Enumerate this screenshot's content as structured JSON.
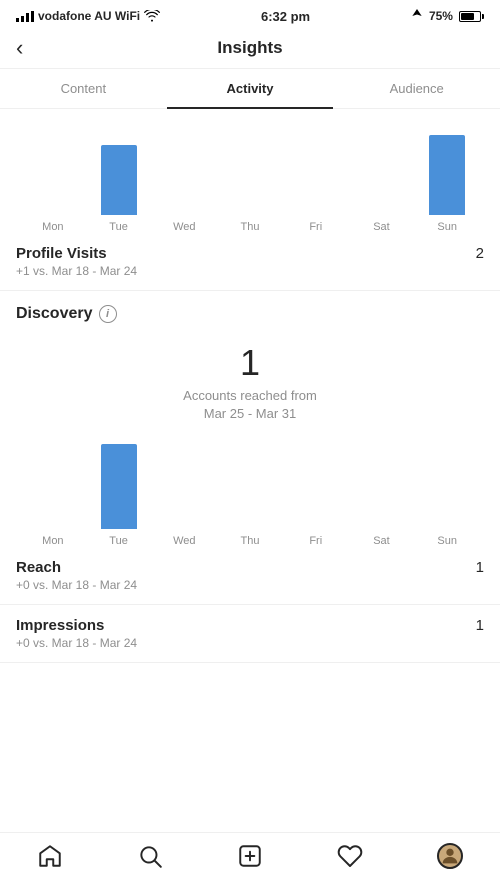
{
  "statusBar": {
    "carrier": "vodafone AU WiFi",
    "time": "6:32 pm",
    "battery": "75%"
  },
  "header": {
    "title": "Insights",
    "backLabel": "<"
  },
  "tabs": [
    {
      "id": "content",
      "label": "Content",
      "active": false
    },
    {
      "id": "activity",
      "label": "Activity",
      "active": true
    },
    {
      "id": "audience",
      "label": "Audience",
      "active": false
    }
  ],
  "topChart": {
    "days": [
      "Mon",
      "Tue",
      "Wed",
      "Thu",
      "Fri",
      "Sat",
      "Sun"
    ],
    "values": [
      0,
      70,
      0,
      0,
      0,
      0,
      80
    ]
  },
  "profileVisits": {
    "label": "Profile Visits",
    "value": "2",
    "comparison": "+1 vs. Mar 18 - Mar 24"
  },
  "discovery": {
    "sectionLabel": "Discovery",
    "infoIcon": "i",
    "accountsNumber": "1",
    "accountsLabel": "Accounts reached from\nMar 25 - Mar 31",
    "chart": {
      "days": [
        "Mon",
        "Tue",
        "Wed",
        "Thu",
        "Fri",
        "Sat",
        "Sun"
      ],
      "values": [
        0,
        85,
        0,
        0,
        0,
        0,
        0
      ]
    },
    "reach": {
      "label": "Reach",
      "value": "1",
      "comparison": "+0 vs. Mar 18 - Mar 24"
    },
    "impressions": {
      "label": "Impressions",
      "value": "1",
      "comparison": "+0 vs. Mar 18 - Mar 24"
    }
  },
  "bottomNav": {
    "items": [
      {
        "id": "home",
        "icon": "home"
      },
      {
        "id": "search",
        "icon": "search"
      },
      {
        "id": "add",
        "icon": "add"
      },
      {
        "id": "heart",
        "icon": "heart"
      },
      {
        "id": "profile",
        "icon": "profile"
      }
    ]
  }
}
